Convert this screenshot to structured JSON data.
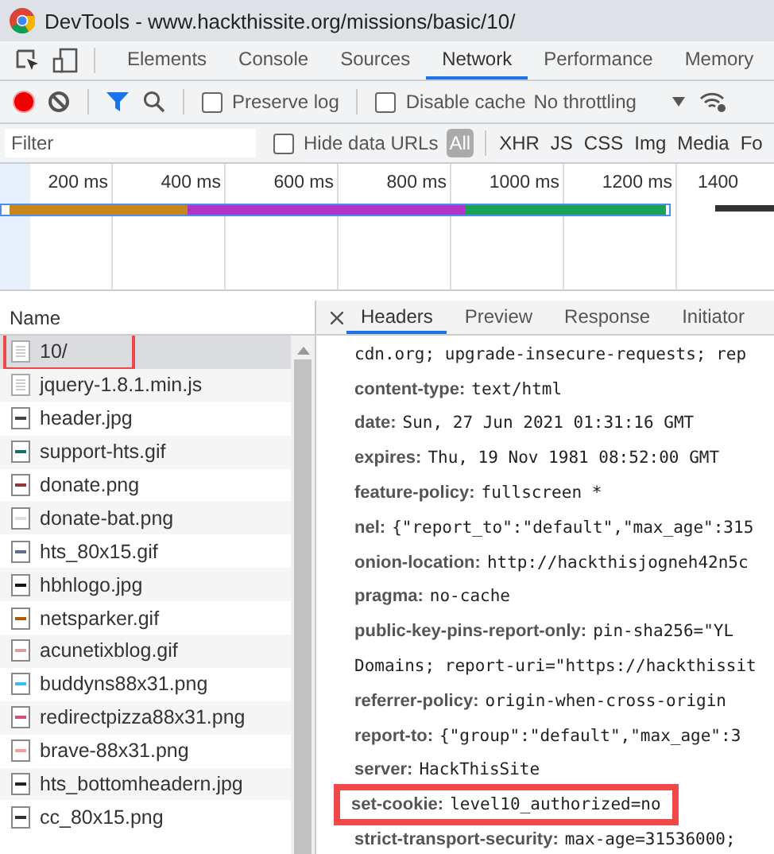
{
  "window": {
    "title": "DevTools - www.hackthissite.org/missions/basic/10/"
  },
  "tabs": [
    {
      "label": "Elements",
      "selected": false
    },
    {
      "label": "Console",
      "selected": false
    },
    {
      "label": "Sources",
      "selected": false
    },
    {
      "label": "Network",
      "selected": true
    },
    {
      "label": "Performance",
      "selected": false
    },
    {
      "label": "Memory",
      "selected": false
    }
  ],
  "toolbar": {
    "recording": true,
    "preserve_log": {
      "label": "Preserve log",
      "checked": false
    },
    "disable_cache": {
      "label": "Disable cache",
      "checked": false
    },
    "throttling": "No throttling"
  },
  "filter_bar": {
    "placeholder": "Filter",
    "hide_data_urls": {
      "label": "Hide data URLs",
      "checked": false
    },
    "types": [
      {
        "label": "All",
        "selected": true
      },
      {
        "label": "XHR",
        "selected": false
      },
      {
        "label": "JS",
        "selected": false
      },
      {
        "label": "CSS",
        "selected": false
      },
      {
        "label": "Img",
        "selected": false
      },
      {
        "label": "Media",
        "selected": false
      },
      {
        "label": "Fo",
        "selected": false
      }
    ]
  },
  "timeline": {
    "ticks": [
      "200 ms",
      "400 ms",
      "600 ms",
      "800 ms",
      "1000 ms",
      "1200 ms",
      "1400"
    ]
  },
  "requests": {
    "column": "Name",
    "rows": [
      {
        "name": "10/",
        "kind": "document",
        "selected": true,
        "highlighted": true
      },
      {
        "name": "jquery-1.8.1.min.js",
        "kind": "document",
        "selected": false,
        "highlighted": false
      },
      {
        "name": "header.jpg",
        "kind": "image",
        "color": "#444444",
        "selected": false,
        "highlighted": false
      },
      {
        "name": "support-hts.gif",
        "kind": "image",
        "color": "#1a6b6b",
        "selected": false,
        "highlighted": false
      },
      {
        "name": "donate.png",
        "kind": "image",
        "color": "#8b3a3a",
        "selected": false,
        "highlighted": false
      },
      {
        "name": "donate-bat.png",
        "kind": "image",
        "color": "#e0e0e0",
        "selected": false,
        "highlighted": false
      },
      {
        "name": "hts_80x15.gif",
        "kind": "image",
        "color": "#5a6f8a",
        "selected": false,
        "highlighted": false
      },
      {
        "name": "hbhlogo.jpg",
        "kind": "image",
        "color": "#111111",
        "selected": false,
        "highlighted": false
      },
      {
        "name": "netsparker.gif",
        "kind": "image",
        "color": "#b35a00",
        "selected": false,
        "highlighted": false
      },
      {
        "name": "acunetixblog.gif",
        "kind": "image",
        "color": "#d9a0a0",
        "selected": false,
        "highlighted": false
      },
      {
        "name": "buddyns88x31.png",
        "kind": "image",
        "color": "#33c0f0",
        "selected": false,
        "highlighted": false
      },
      {
        "name": "redirectpizza88x31.png",
        "kind": "image",
        "color": "#d04f80",
        "selected": false,
        "highlighted": false
      },
      {
        "name": "brave-88x31.png",
        "kind": "image",
        "color": "#f0a090",
        "selected": false,
        "highlighted": false
      },
      {
        "name": "hts_bottomheadern.jpg",
        "kind": "image",
        "color": "#222222",
        "selected": false,
        "highlighted": false
      },
      {
        "name": "cc_80x15.png",
        "kind": "image",
        "color": "#333333",
        "selected": false,
        "highlighted": false
      }
    ]
  },
  "detail": {
    "tabs": [
      {
        "label": "Headers",
        "selected": true
      },
      {
        "label": "Preview",
        "selected": false
      },
      {
        "label": "Response",
        "selected": false
      },
      {
        "label": "Initiator",
        "selected": false
      }
    ],
    "headers": [
      {
        "value": "cdn.org; upgrade-insecure-requests; rep",
        "highlighted": false
      },
      {
        "name": "content-type:",
        "value": "text/html",
        "highlighted": false
      },
      {
        "name": "date:",
        "value": "Sun, 27 Jun 2021 01:31:16 GMT",
        "highlighted": false
      },
      {
        "name": "expires:",
        "value": "Thu, 19 Nov 1981 08:52:00 GMT",
        "highlighted": false
      },
      {
        "name": "feature-policy:",
        "value": "fullscreen *",
        "highlighted": false
      },
      {
        "name": "nel:",
        "value": "{\"report_to\":\"default\",\"max_age\":315",
        "highlighted": false
      },
      {
        "name": "onion-location:",
        "value": "http://hackthisjogneh42n5c",
        "highlighted": false
      },
      {
        "name": "pragma:",
        "value": "no-cache",
        "highlighted": false
      },
      {
        "name": "public-key-pins-report-only:",
        "value": "pin-sha256=\"YL",
        "highlighted": false
      },
      {
        "value": "Domains; report-uri=\"https://hackthissit",
        "highlighted": false
      },
      {
        "name": "referrer-policy:",
        "value": "origin-when-cross-origin",
        "highlighted": false
      },
      {
        "name": "report-to:",
        "value": "{\"group\":\"default\",\"max_age\":3",
        "highlighted": false
      },
      {
        "name": "server:",
        "value": "HackThisSite",
        "highlighted": false
      },
      {
        "name": "set-cookie:",
        "value": "level10_authorized=no",
        "highlighted": true
      },
      {
        "name": "strict-transport-security:",
        "value": "max-age=31536000;",
        "highlighted": false
      }
    ]
  }
}
